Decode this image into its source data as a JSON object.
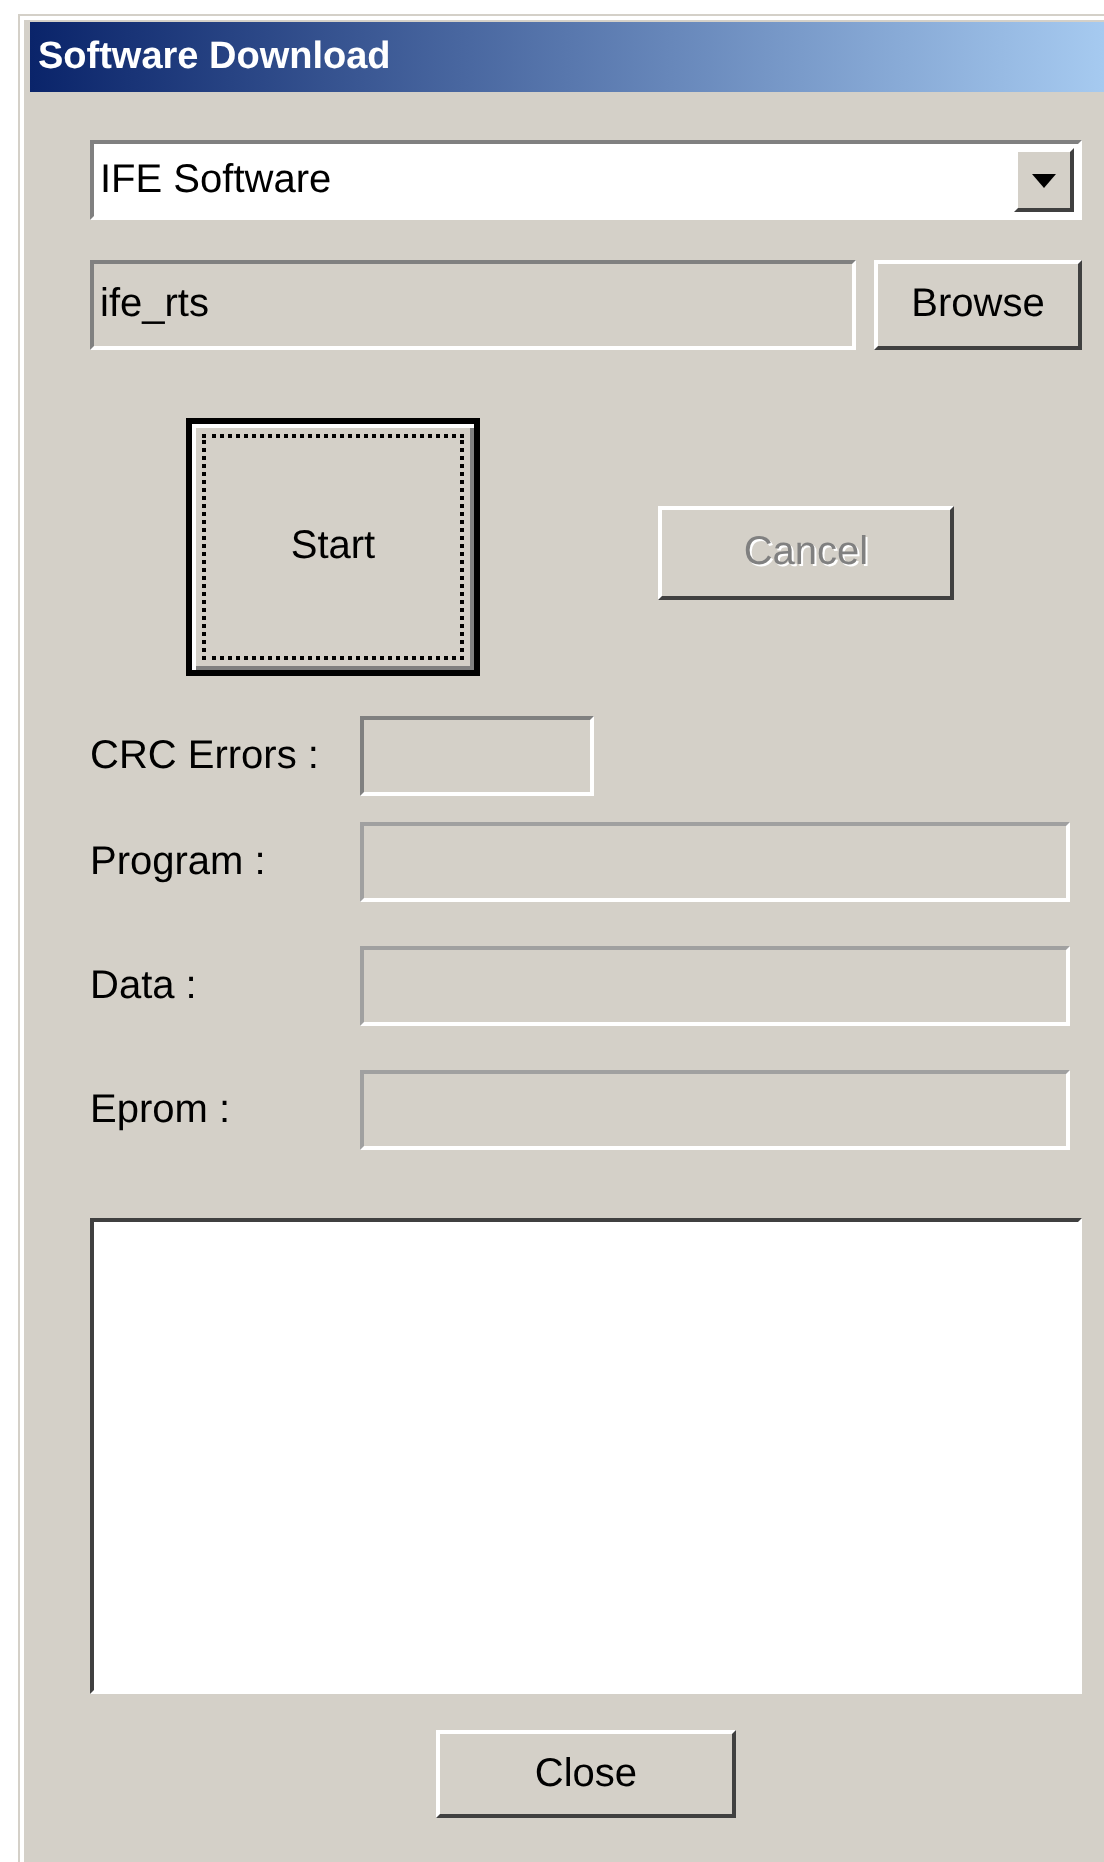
{
  "window": {
    "title": "Software Download"
  },
  "software_select": {
    "value": "IFE Software"
  },
  "file_field": {
    "value": "ife_rts"
  },
  "browse_button": {
    "label": "Browse"
  },
  "start_button": {
    "label": "Start",
    "focused": true
  },
  "cancel_button": {
    "label": "Cancel",
    "disabled": true
  },
  "status_fields": [
    {
      "label": "CRC Errors :",
      "kind": "count",
      "disabled": false
    },
    {
      "label": "Program :",
      "kind": "progress",
      "disabled": true
    },
    {
      "label": "Data :",
      "kind": "progress",
      "disabled": true
    },
    {
      "label": "Eprom :",
      "kind": "progress",
      "disabled": true
    }
  ],
  "close_button": {
    "label": "Close"
  }
}
